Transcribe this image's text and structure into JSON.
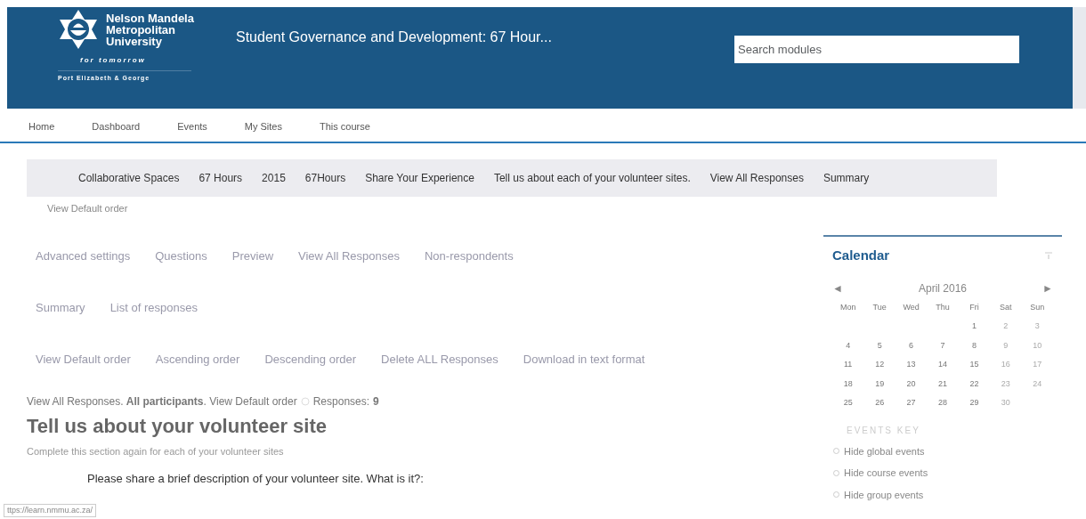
{
  "header": {
    "logo": {
      "name_lines": [
        "Nelson Mandela",
        "Metropolitan",
        "University"
      ],
      "tagline": "for tomorrow",
      "campus": "Port Elizabeth & George"
    },
    "course_title": "Student Governance and Development: 67 Hour...",
    "search": {
      "placeholder": "Search modules"
    }
  },
  "nav": [
    "Home",
    "Dashboard",
    "Events",
    "My Sites",
    "This course"
  ],
  "breadcrumb": [
    "Collaborative Spaces",
    "67 Hours",
    "2015",
    "67Hours",
    "Share Your Experience",
    "Tell us about each of your volunteer sites.",
    "View All Responses",
    "Summary"
  ],
  "breadcrumb_sub": "View Default order",
  "tab_rows": [
    [
      "Advanced settings",
      "Questions",
      "Preview",
      "View All Responses",
      "Non-respondents"
    ],
    [
      "Summary",
      "List of responses"
    ],
    [
      "View Default order",
      "Ascending order",
      "Descending order",
      "Delete ALL Responses",
      "Download in text format"
    ]
  ],
  "response_line": "View All Responses. **All participants**. View Default order",
  "responses_label": "Responses:",
  "responses_count": "9",
  "heading": "Tell us about your volunteer site",
  "intro": "Complete this section again for each of your volunteer sites",
  "question": "Please share a brief description of your volunteer site. What is it?:",
  "status_url": "ttps://learn.nmmu.ac.za/",
  "calendar": {
    "title": "Calendar",
    "prev": "◄",
    "month": "April 2016",
    "next": "►",
    "weekdays": [
      "Mon",
      "Tue",
      "Wed",
      "Thu",
      "Fri",
      "Sat",
      "Sun"
    ],
    "weeks": [
      [
        "1",
        "2",
        "3"
      ],
      [
        "4",
        "5",
        "6",
        "7",
        "8",
        "9",
        "10"
      ],
      [
        "11",
        "12",
        "13",
        "14",
        "15",
        "16",
        "17"
      ],
      [
        "18",
        "19",
        "20",
        "21",
        "22",
        "23",
        "24"
      ],
      [
        "25",
        "26",
        "27",
        "28",
        "29",
        "30"
      ]
    ],
    "events_key": "EVENTS KEY",
    "event_toggles": [
      "Hide global events",
      "Hide course events",
      "Hide group events"
    ]
  }
}
